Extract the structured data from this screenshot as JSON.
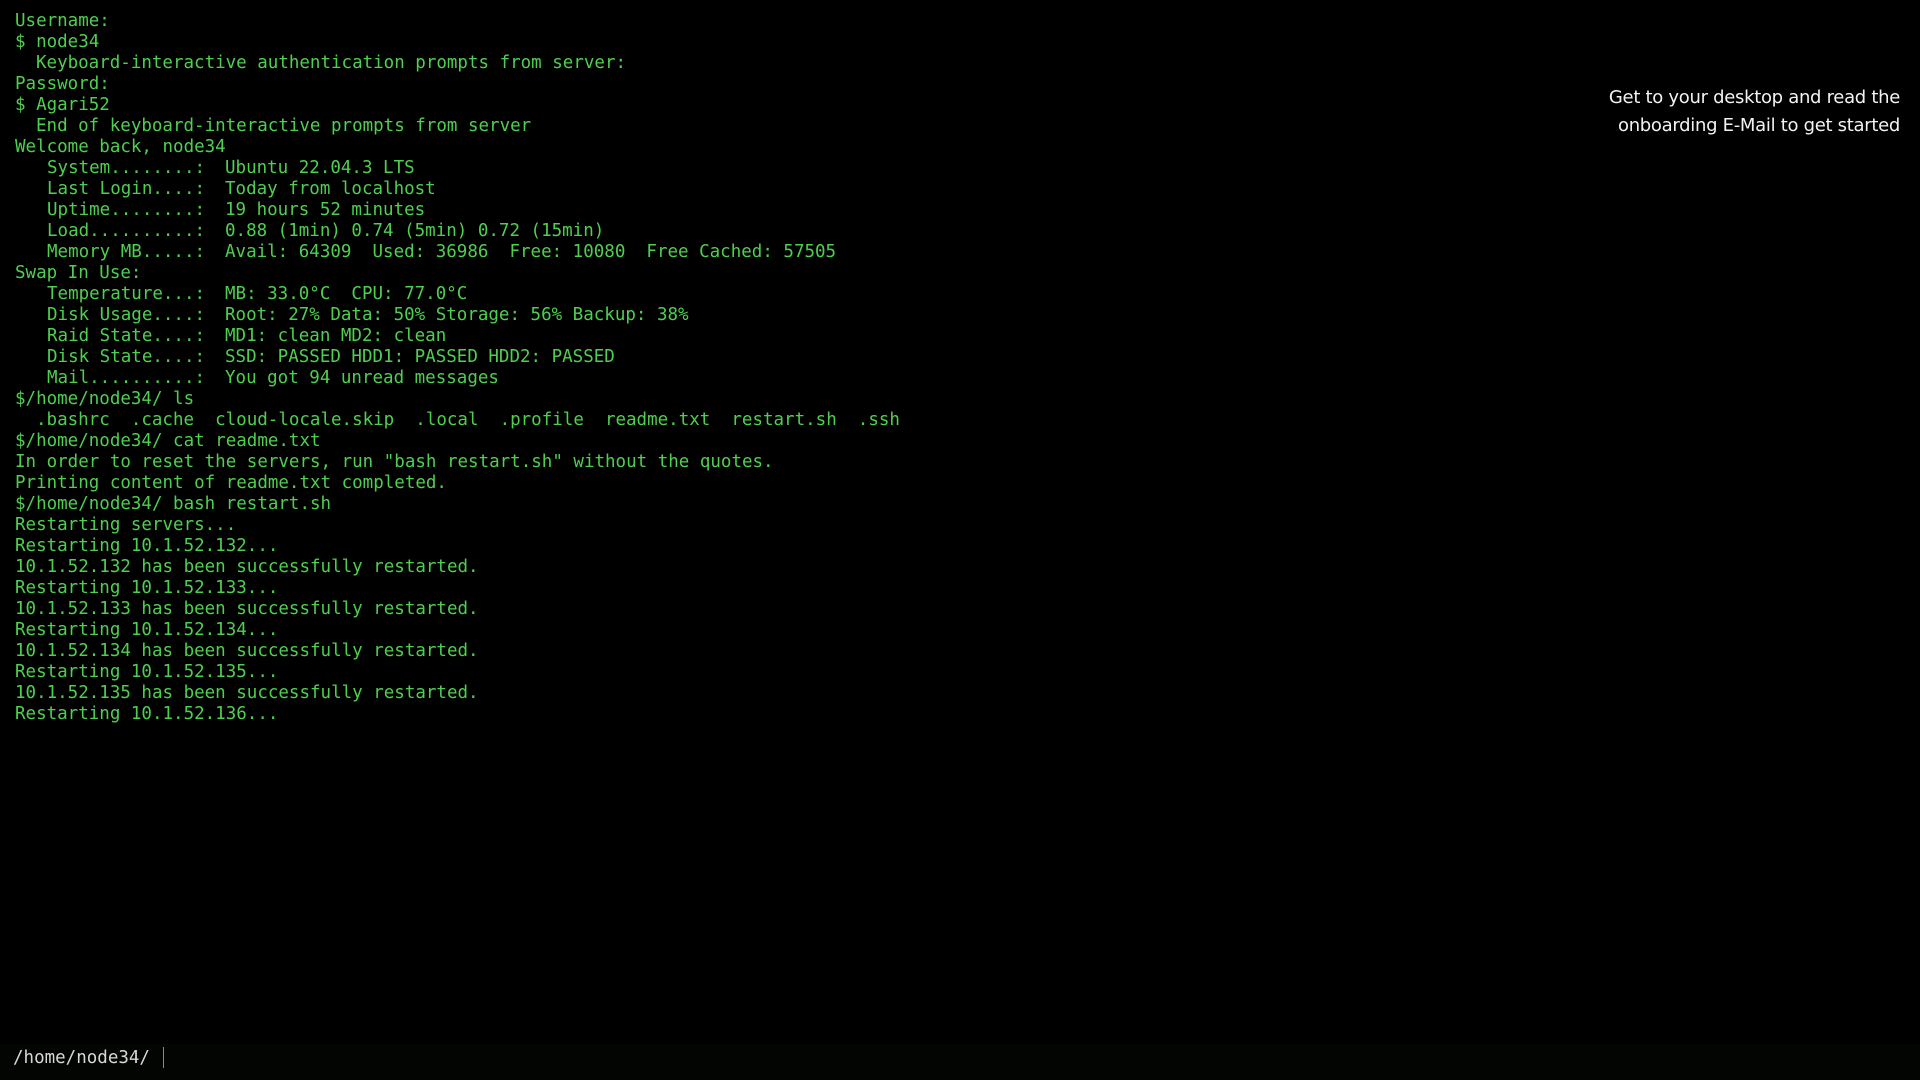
{
  "terminal": {
    "lines": [
      "Username:",
      "$ node34",
      "Keyboard-interactive authentication prompts from server:",
      "Password:",
      "$ Agari52",
      "End of keyboard-interactive prompts from server",
      "Welcome back, node34"
    ],
    "sysinfo": [
      {
        "label": "System........:",
        "value": "Ubuntu 22.04.3 LTS"
      },
      {
        "label": "Last Login....:",
        "value": "Today from localhost"
      },
      {
        "label": "Uptime........:",
        "value": "19 hours 52 minutes"
      },
      {
        "label": "Load..........:",
        "value": "0.88 (1min) 0.74 (5min) 0.72 (15min)"
      },
      {
        "label": "Memory MB.....:",
        "value": "Avail: 64309  Used: 36986  Free: 10080  Free Cached: 57505"
      }
    ],
    "swap_line": "Swap In Use:",
    "sysinfo2": [
      {
        "label": "Temperature...:",
        "value": "MB: 33.0°C  CPU: 77.0°C"
      },
      {
        "label": "Disk Usage....:",
        "value": "Root: 27% Data: 50% Storage: 56% Backup: 38%"
      },
      {
        "label": "Raid State....:",
        "value": "MD1: clean MD2: clean"
      },
      {
        "label": "Disk State....:",
        "value": "SSD: PASSED HDD1: PASSED HDD2: PASSED"
      },
      {
        "label": "Mail..........:",
        "value": "You got 94 unread messages"
      }
    ],
    "cmd_ls": "$/home/node34/ ls",
    "ls_output": ".bashrc  .cache  cloud-locale.skip  .local  .profile  readme.txt  restart.sh  .ssh",
    "cmd_cat": "$/home/node34/ cat readme.txt",
    "readme_line": "In order to reset the servers, run \"bash restart.sh\" without the quotes.",
    "readme_done": "Printing content of readme.txt completed.",
    "cmd_bash": "$/home/node34/ bash restart.sh",
    "restart_lines": [
      "Restarting servers...",
      "Restarting 10.1.52.132...",
      "10.1.52.132 has been successfully restarted.",
      "Restarting 10.1.52.133...",
      "10.1.52.133 has been successfully restarted.",
      "Restarting 10.1.52.134...",
      "10.1.52.134 has been successfully restarted.",
      "Restarting 10.1.52.135...",
      "10.1.52.135 has been successfully restarted.",
      "Restarting 10.1.52.136..."
    ]
  },
  "hint": {
    "line1": "Get to your desktop and read the",
    "line2": "onboarding E-Mail to get started"
  },
  "prompt": {
    "path": "/home/node34/",
    "input_value": ""
  },
  "colors": {
    "background": "#000000",
    "terminal_text": "#4fcf4f",
    "hint_text": "#f2f2f2",
    "prompt_text": "#d8d8d8"
  }
}
